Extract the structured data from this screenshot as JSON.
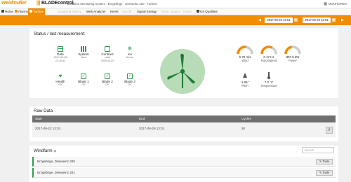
{
  "header": {
    "brand_left": "Weidmüller",
    "brand_right": "BLADEcontrol",
    "title": "Condition Monitoring System - Erzgebirge - Dreiweinz 200 - Turbine",
    "user": "MONITORER"
  },
  "nav": {
    "items": [
      {
        "label": "Home",
        "icon": "home-icon",
        "enabled": true,
        "active": false
      },
      {
        "label": "Alarms",
        "icon": "bell-icon",
        "enabled": true,
        "active": false
      },
      {
        "label": "Turbine",
        "icon": "turbine-icon",
        "enabled": true,
        "active": true
      },
      {
        "label": "Graphical history",
        "icon": "chart-icon",
        "enabled": false,
        "active": false
      },
      {
        "label": "Web Analyzer",
        "icon": "",
        "enabled": true,
        "active": false
      },
      {
        "label": "KeVis",
        "icon": "",
        "enabled": true,
        "active": false
      },
      {
        "label": "Op-Off",
        "icon": "",
        "enabled": false,
        "active": false
      },
      {
        "label": "Signal Energy",
        "icon": "",
        "enabled": true,
        "active": false
      },
      {
        "label": "Static Inspect",
        "icon": "",
        "enabled": false,
        "active": false
      },
      {
        "label": "InSoft",
        "icon": "",
        "enabled": false,
        "active": false
      },
      {
        "label": "Ice Qualities",
        "icon": "snowflake-icon",
        "enabled": true,
        "active": false
      }
    ]
  },
  "datebar": {
    "from": "2017-09-22 12:01",
    "to": "2017-09-29 12:01",
    "accent": "#f28c00"
  },
  "status": {
    "title": "Status / last measurement:",
    "tiles_row1": [
      {
        "label": "Date",
        "sub": [
          "2017-09-28",
          "22:20:52"
        ],
        "icon": "calendar-icon"
      },
      {
        "label": "System",
        "sub": [
          "Alive"
        ],
        "icon": "system-icon"
      },
      {
        "label": "Contract",
        "sub": [
          "valid",
          "2099-09-07"
        ],
        "icon": "handshake-icon"
      },
      {
        "label": "Ice",
        "sub": [
          "No ice"
        ],
        "icon": "snowflake-icon"
      }
    ],
    "tiles_row2": [
      {
        "label": "Health",
        "sub": [
          "OK"
        ],
        "icon": "heart-icon"
      },
      {
        "label": "Blade 1",
        "sub": [
          "OK"
        ],
        "icon": "blade-icon"
      },
      {
        "label": "Blade 2",
        "sub": [
          "OK"
        ],
        "icon": "blade-icon"
      },
      {
        "label": "Blade 3",
        "sub": [
          "OK"
        ],
        "icon": "blade-icon"
      }
    ],
    "gauges": [
      {
        "value": "6.79 m/s",
        "label": "Wind",
        "fraction": 0.55
      },
      {
        "value": "0.17 Hz",
        "label": "RotorSpeed",
        "fraction": 0.65
      },
      {
        "value": "897.5 kW",
        "label": "Power",
        "fraction": 0.45
      }
    ],
    "readouts": [
      {
        "value": "-1.89 °",
        "label": "Pitch"
      },
      {
        "value": "7.0 °C",
        "label": "Temperature"
      }
    ],
    "ok_color": "#2e9e4e",
    "turbine_bg": "#b8dcb8"
  },
  "raw_data": {
    "title": "Raw Data",
    "columns": [
      "Start",
      "End",
      "Cycles"
    ],
    "rows": [
      {
        "start": "2017-09-22 12:01",
        "end": "2017-09-29 12:01",
        "cycles": "50"
      }
    ]
  },
  "windfarm": {
    "title": "Windfarm",
    "search_placeholder": "Search",
    "rows": [
      {
        "name": "Erzgebirge, Dreiweinz 200",
        "tools": "Tools"
      },
      {
        "name": "Erzgebirge, Dreiweinz 201",
        "tools": "Tools"
      }
    ]
  }
}
